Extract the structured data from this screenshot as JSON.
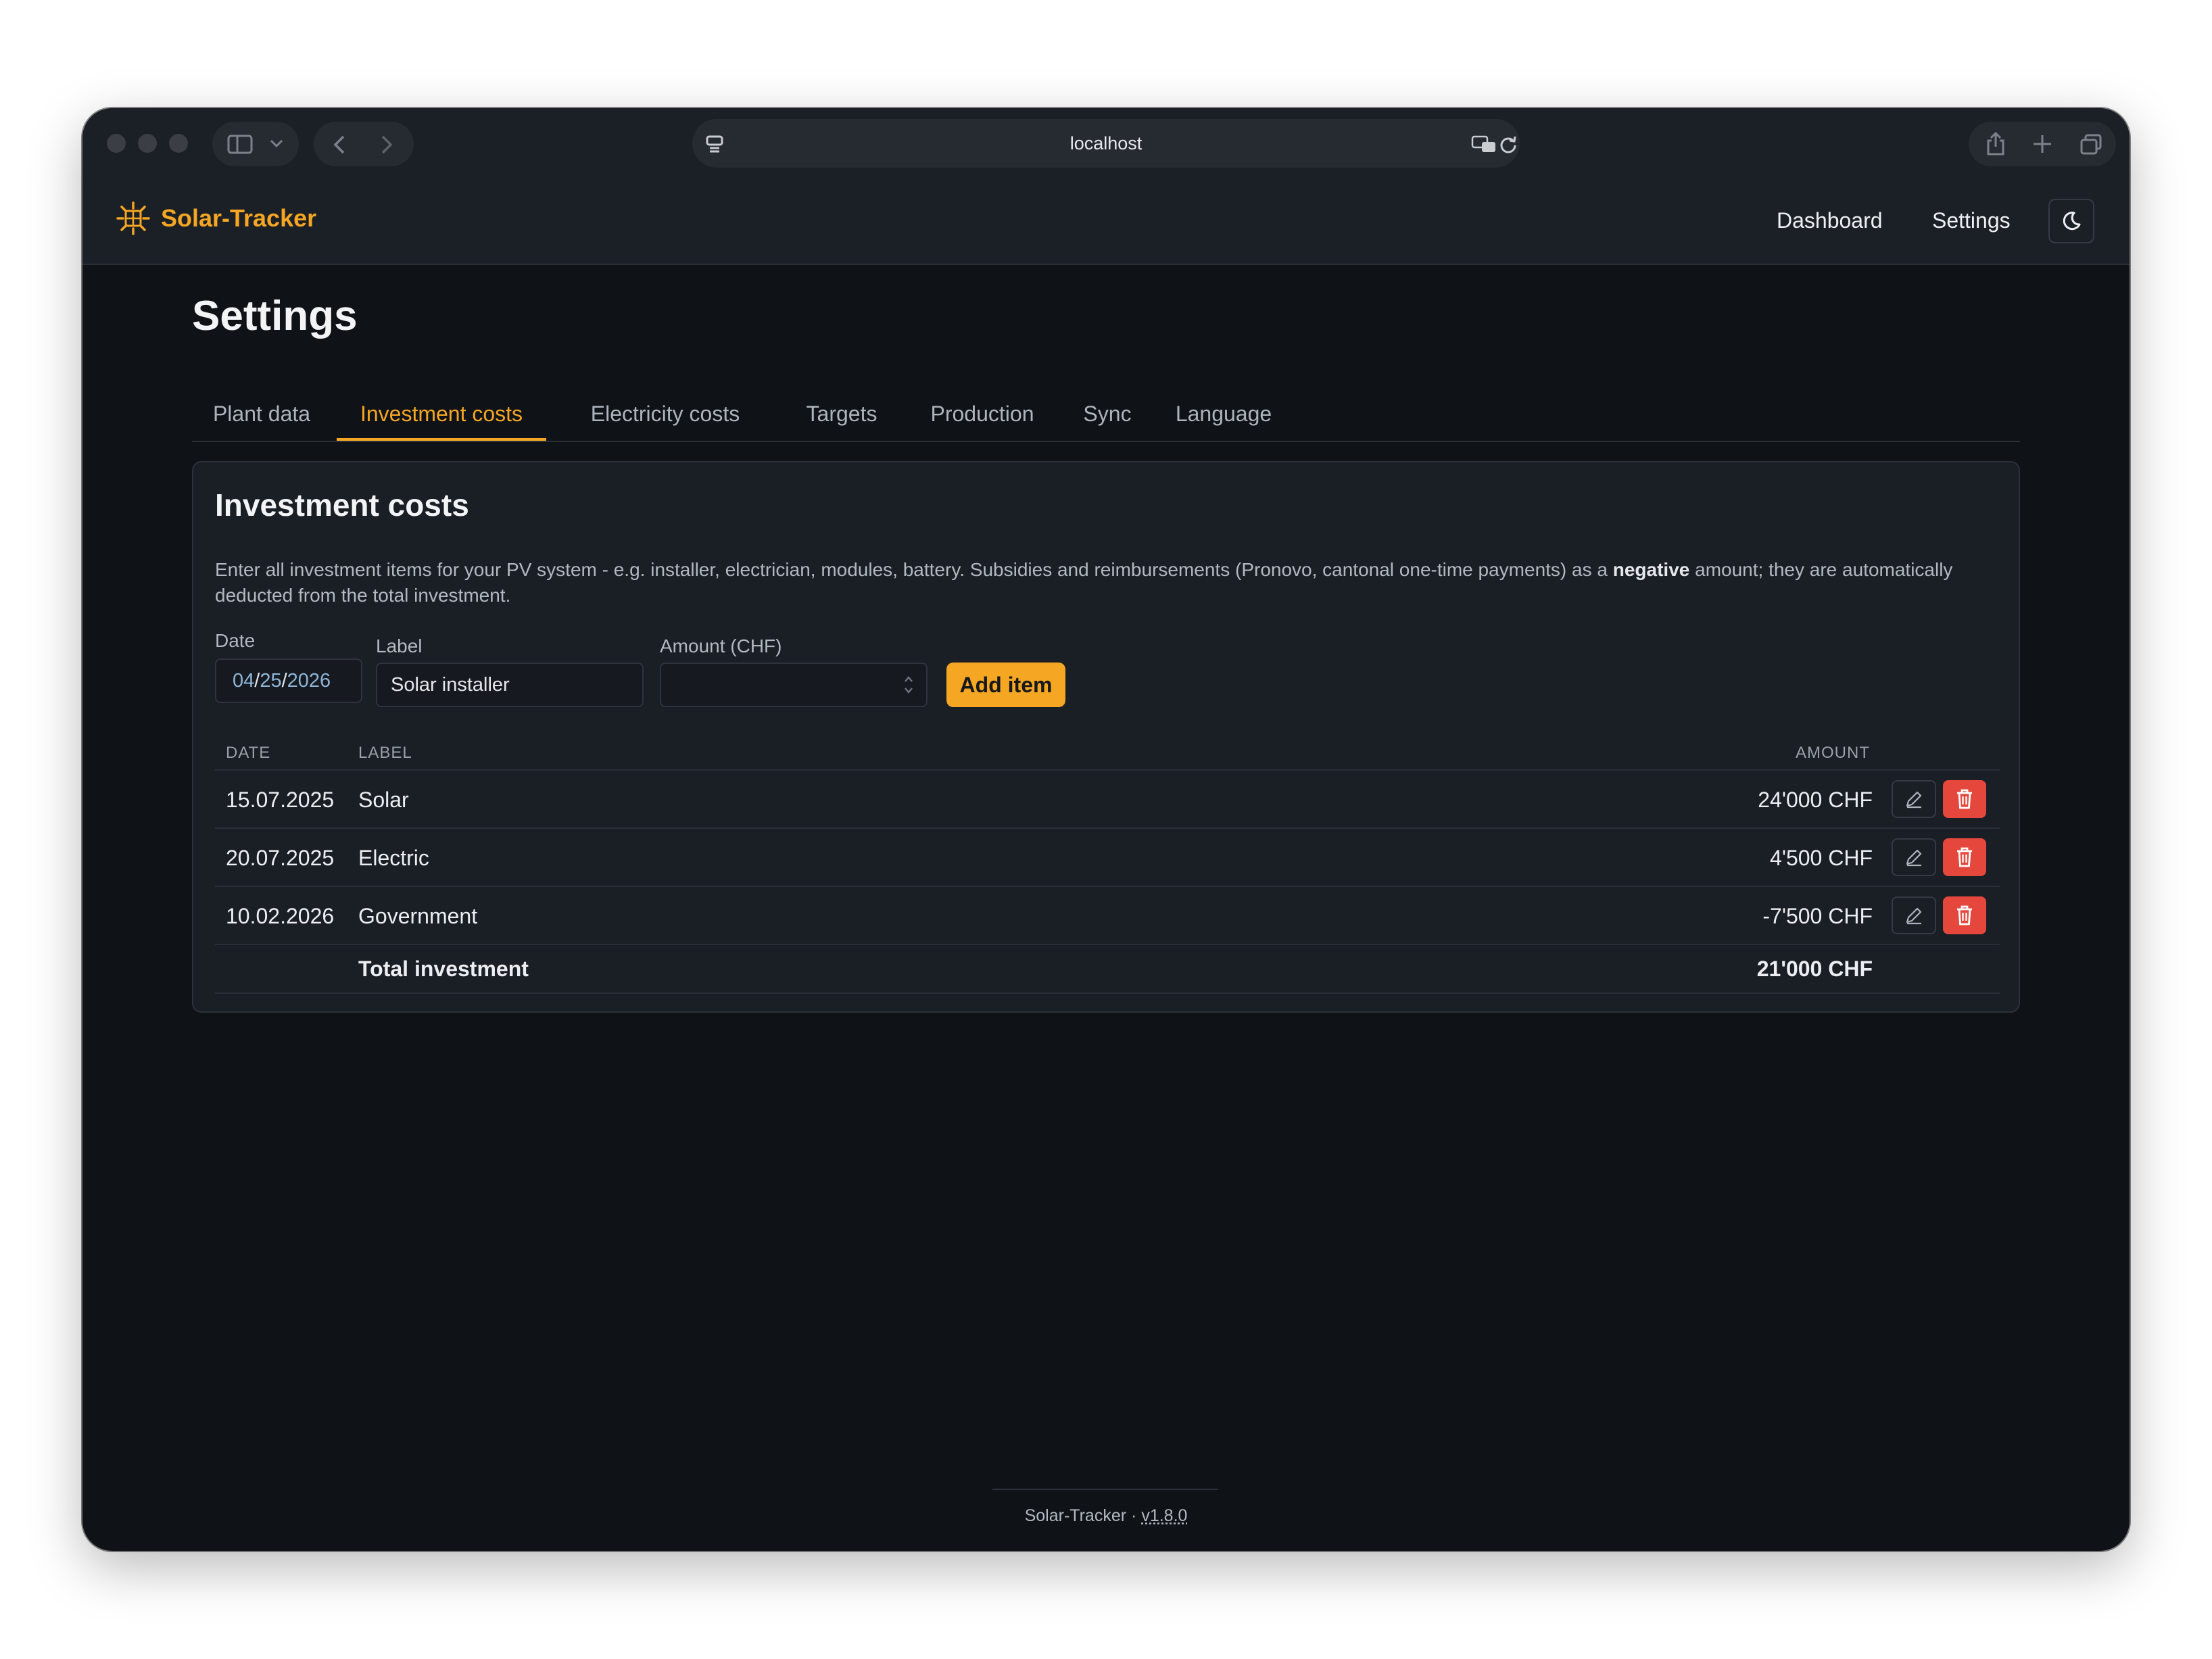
{
  "browser": {
    "address": "localhost"
  },
  "app": {
    "brand": "Solar-Tracker",
    "nav": [
      "Dashboard",
      "Settings"
    ],
    "accent": "#f5a623"
  },
  "page": {
    "title": "Settings",
    "tabs": [
      "Plant data",
      "Investment costs",
      "Electricity costs",
      "Targets",
      "Production",
      "Sync",
      "Language"
    ],
    "active_tab": "Investment costs"
  },
  "card": {
    "title": "Investment costs",
    "desc_before": "Enter all investment items for your PV system - e.g. installer, electrician, modules, battery. Subsidies and reimbursements (Pronovo, cantonal one-time payments) as a ",
    "desc_bold": "negative",
    "desc_after": " amount; they are automatically deducted from the total investment."
  },
  "form": {
    "date_label": "Date",
    "date_month": "04",
    "date_day": "25",
    "date_year": "2026",
    "label_label": "Label",
    "label_value": "Solar installer",
    "amount_label": "Amount (CHF)",
    "amount_value": "",
    "add_button": "Add item"
  },
  "table": {
    "headers": {
      "date": "DATE",
      "label": "LABEL",
      "amount": "AMOUNT"
    },
    "rows": [
      {
        "date": "15.07.2025",
        "label": "Solar",
        "amount": "24'000 CHF"
      },
      {
        "date": "20.07.2025",
        "label": "Electric",
        "amount": "4'500 CHF"
      },
      {
        "date": "10.02.2026",
        "label": "Government",
        "amount": "-7'500 CHF"
      }
    ],
    "total_label": "Total investment",
    "total_amount": "21'000 CHF"
  },
  "footer": {
    "name": "Solar-Tracker",
    "separator": "·",
    "version": "v1.8.0"
  },
  "icons": {
    "brand": "sun-icon",
    "theme": "moon-icon",
    "edit": "pencil-icon",
    "delete": "trash-icon"
  }
}
